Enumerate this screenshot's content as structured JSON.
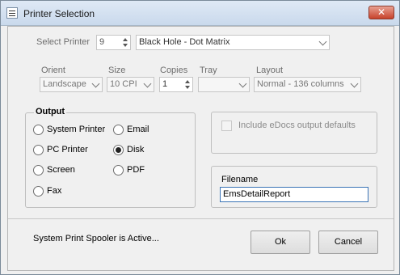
{
  "window": {
    "title": "Printer Selection",
    "close_glyph": "✕"
  },
  "printer": {
    "label": "Select Printer",
    "number": "9",
    "name": "Black Hole - Dot Matrix"
  },
  "options": {
    "orient_label": "Orient",
    "orient_value": "Landscape",
    "size_label": "Size",
    "size_value": "10 CPI",
    "copies_label": "Copies",
    "copies_value": "1",
    "tray_label": "Tray",
    "tray_value": "",
    "layout_label": "Layout",
    "layout_value": "Normal - 136 columns"
  },
  "output": {
    "title": "Output",
    "options": [
      {
        "label": "System Printer",
        "selected": false
      },
      {
        "label": "Email",
        "selected": false
      },
      {
        "label": "PC Printer",
        "selected": false
      },
      {
        "label": "Disk",
        "selected": true
      },
      {
        "label": "Screen",
        "selected": false
      },
      {
        "label": "PDF",
        "selected": false
      },
      {
        "label": "Fax",
        "selected": false
      }
    ]
  },
  "edocs": {
    "label": "Include eDocs output defaults",
    "checked": false
  },
  "filename": {
    "label": "Filename",
    "value": "EmsDetailReport"
  },
  "status": {
    "text": "System Print Spooler is Active..."
  },
  "buttons": {
    "ok": "Ok",
    "cancel": "Cancel"
  },
  "icons": {
    "app": "printer-list-icon",
    "close": "close-icon",
    "dropdown": "chevron-down-icon",
    "spinner": "spinner-arrows-icon"
  },
  "colors": {
    "close_button": "#c7422b",
    "focus_border": "#3b74b6",
    "titlebar": "#c9d9ec"
  }
}
